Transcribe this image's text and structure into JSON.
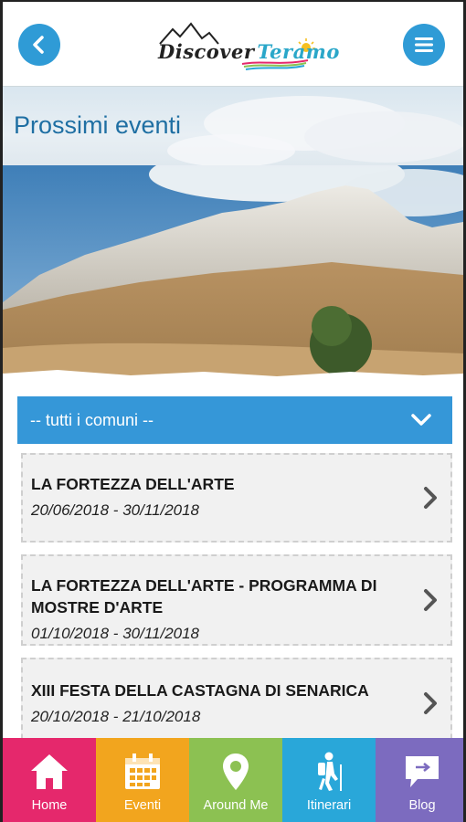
{
  "header": {
    "logo_word1": "Discover",
    "logo_word2": "Teramo"
  },
  "page": {
    "title": "Prossimi eventi"
  },
  "filter": {
    "selected": "-- tutti i comuni --"
  },
  "events": [
    {
      "title": "LA FORTEZZA DELL'ARTE",
      "dates": "20/06/2018 - 30/11/2018"
    },
    {
      "title": "LA FORTEZZA DELL'ARTE - PROGRAMMA DI MOSTRE D'ARTE",
      "dates": "01/10/2018 - 30/11/2018"
    },
    {
      "title": "XIII FESTA DELLA CASTAGNA DI SENARICA",
      "dates": "20/10/2018 - 21/10/2018"
    }
  ],
  "nav": [
    {
      "label": "Home",
      "icon": "home-icon",
      "color": "#e5286c"
    },
    {
      "label": "Eventi",
      "icon": "calendar-icon",
      "color": "#f2a51e"
    },
    {
      "label": "Around Me",
      "icon": "location-pin-icon",
      "color": "#8cc152"
    },
    {
      "label": "Itinerari",
      "icon": "hiker-icon",
      "color": "#29a7d9"
    },
    {
      "label": "Blog",
      "icon": "chat-bubble-icon",
      "color": "#7c6bbf"
    }
  ],
  "colors": {
    "accent": "#2f9bd6",
    "title": "#1f6fa3",
    "dropdown": "#3597d8"
  }
}
